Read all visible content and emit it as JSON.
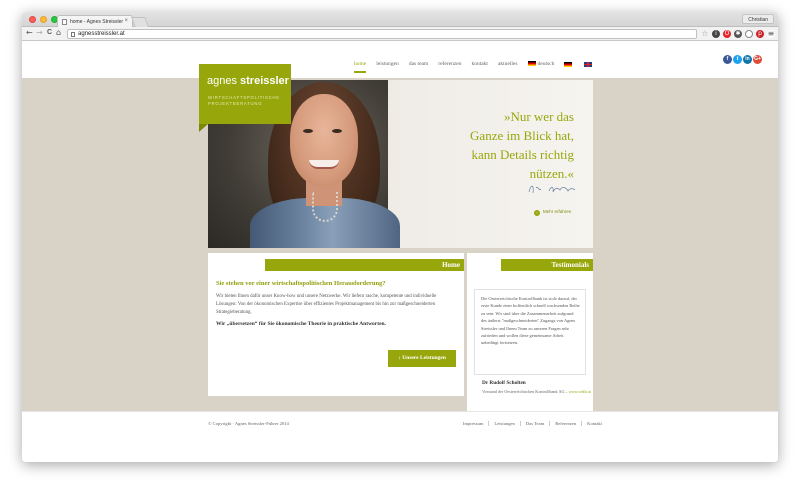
{
  "browser": {
    "tab_title": "home - Agnes Streissler",
    "tab_close": "×",
    "profile_name": "Christian",
    "url": "agnesstreissler.at",
    "nav": {
      "back": "←",
      "forward": "→",
      "reload": "C",
      "home": "⌂"
    }
  },
  "logo": {
    "first": "agnes ",
    "last": "streissler",
    "subtitle": "Wirtschaftspolitische Projektberatung"
  },
  "nav": {
    "items": [
      "home",
      "leistungen",
      "das team",
      "referenzen",
      "kontakt",
      "aktuelles"
    ],
    "lang_label": "deutsch"
  },
  "social": {
    "facebook": "f",
    "twitter": "t",
    "linkedin": "in",
    "googleplus": "G+"
  },
  "hero": {
    "quote_lines": [
      "»Nur wer das",
      "Ganze im Blick hat,",
      "kann Details richtig",
      "nützen.«"
    ],
    "more_link": "Mehr erfahren",
    "more_icon": "›"
  },
  "home_panel": {
    "title": "Home",
    "heading": "Sie stehen vor einer wirtschaftspolitischen Herausforderung?",
    "body": "Wir bieten Ihnen dafür unser Know-how und unsere Netzwerke. Wir liefern rasche, kompetente und individuelle Lösungen: Von der ökonomischen Expertise über effizientes Projektmanagement bis hin zur maßgeschneiderten Strategieberatung.",
    "strong": "Wir „übersetzen“ für Sie ökonomische Theorie in praktische Antworten.",
    "button": "↓ Unsere Leistungen"
  },
  "testimonials": {
    "title": "Testimonials",
    "quote": "Die Oesterreichische Kontrollbank ist stolz darauf, der erste Kunde einer hoffentlich schnell wachsenden Reihe zu sein. Wir sind über die Zusammenarbeit aufgrund des äußerst \"maßgeschneiderten\" Zugangs von Agnes Streissler und Ihrem Team zu unseren Fragen sehr zufrieden und wollen diese gemeinsame Arbeit unbedingt fortsetzen.",
    "name": "Dr Rudolf Scholten",
    "role": "Vorstand der Oesterreichischen Kontrollbank AG – ",
    "link": "www.oekb.at"
  },
  "footer": {
    "copyright": "© Copyright · Agnes Streissler-Führer 2014",
    "links": [
      "Impressum",
      "Leistungen",
      "Das Team",
      "Referenzen",
      "Kontakt"
    ]
  },
  "colors": {
    "accent": "#97a70b",
    "background": "#d8d3c6"
  }
}
